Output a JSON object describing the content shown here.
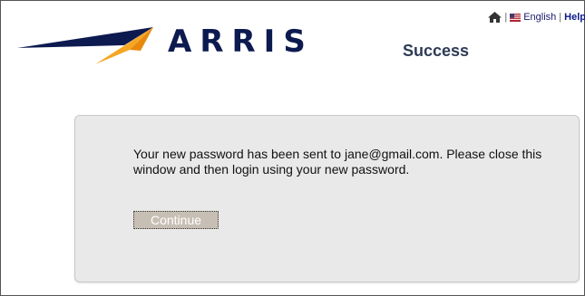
{
  "header": {
    "logo_text": "ARRIS",
    "links": {
      "home_icon": "home-icon",
      "flag_icon": "us-flag-icon",
      "language": "English",
      "help": "Help",
      "separator": "|"
    }
  },
  "page": {
    "title": "Success"
  },
  "panel": {
    "message": "Your new password has been sent to jane@gmail.com. Please close this window and then login using your new password.",
    "continue_label": "Continue"
  },
  "colors": {
    "brand_navy": "#0c1a4f",
    "brand_orange": "#f5a623",
    "title": "#2d3b55",
    "panel_bg": "#e9e9e9",
    "button_bg": "#c8bfb4"
  }
}
